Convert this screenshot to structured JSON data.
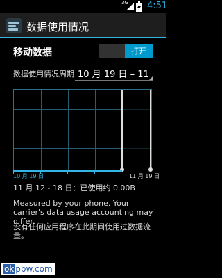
{
  "status_bar": {
    "network": "3G",
    "time": "4:51",
    "icons": [
      "signal-icon",
      "battery-icon"
    ]
  },
  "action_bar": {
    "title": "数据使用情况",
    "icon": "data-usage-icon"
  },
  "mobile_data": {
    "label": "移动数据",
    "toggle_label": "打开",
    "enabled": true
  },
  "cycle": {
    "label": "数据使用情况周期",
    "value": "10 月 19 日 – 11"
  },
  "chart": {
    "start_label": "10 月 19 日",
    "end_label": "11 月 19 日"
  },
  "summary": "11 月 12 - 18 日：已使用约 0.00B",
  "note": "Measured by your phone. Your carrier's data usage accounting may differ.",
  "no_apps": "没有任何应用程序在此期间使用过数据流量。",
  "watermark": {
    "prefix": "ok",
    "suffix": "pbw.com"
  },
  "colors": {
    "accent": "#33b5e5",
    "toggle_on": "#0099cc"
  }
}
